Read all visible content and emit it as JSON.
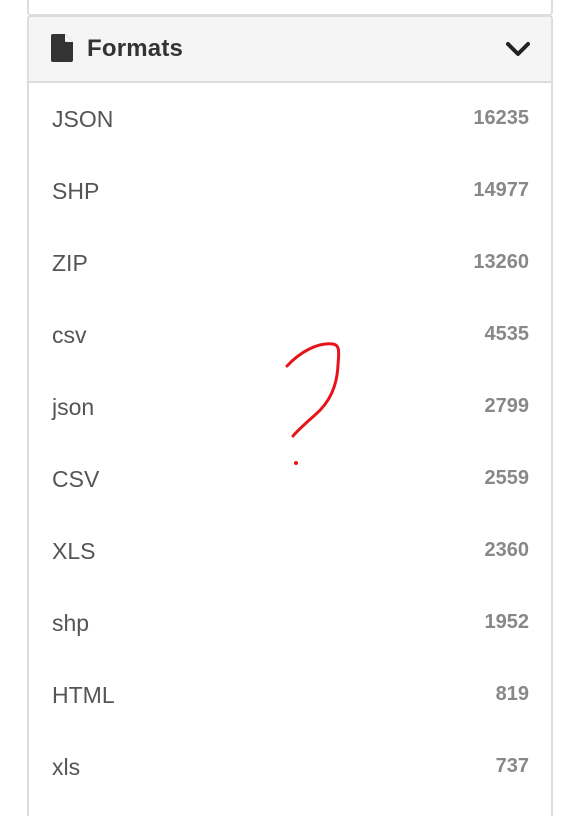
{
  "panel": {
    "title": "Formats",
    "icon": "file-icon",
    "toggle_icon": "chevron-down-icon"
  },
  "formats": [
    {
      "label": "JSON",
      "count": "16235"
    },
    {
      "label": "SHP",
      "count": "14977"
    },
    {
      "label": "ZIP",
      "count": "13260"
    },
    {
      "label": "csv",
      "count": "4535"
    },
    {
      "label": "json",
      "count": "2799"
    },
    {
      "label": "CSV",
      "count": "2559"
    },
    {
      "label": "XLS",
      "count": "2360"
    },
    {
      "label": "shp",
      "count": "1952"
    },
    {
      "label": "HTML",
      "count": "819"
    },
    {
      "label": "xls",
      "count": "737"
    }
  ],
  "annotation": {
    "type": "hand-drawn question mark",
    "color": "#e8141b"
  },
  "colors": {
    "header_bg": "#f5f5f5",
    "border": "#dddddd",
    "label_text": "#555555",
    "count_text": "#888888",
    "title_text": "#333333"
  }
}
